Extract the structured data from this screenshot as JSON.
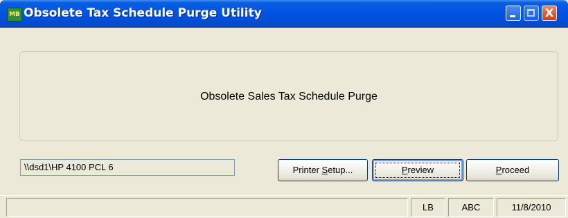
{
  "window": {
    "title": "Obsolete Tax Schedule Purge Utility",
    "icon": "mas90-app-icon",
    "icon_text": "MB"
  },
  "title_buttons": {
    "minimize": "minimize",
    "maximize": "maximize",
    "close": "X"
  },
  "main": {
    "caption": "Obsolete Sales Tax Schedule Purge"
  },
  "printer": {
    "value": "\\\\dsd1\\HP 4100 PCL 6"
  },
  "buttons": {
    "printer_setup": {
      "before": "Printer ",
      "accel": "S",
      "after": "etup..."
    },
    "preview": {
      "before": "",
      "accel": "P",
      "after": "review"
    },
    "proceed": {
      "before": "",
      "accel": "P",
      "after": "roceed"
    }
  },
  "status_bar": {
    "main": "",
    "user": "LB",
    "company": "ABC",
    "date": "11/8/2010"
  },
  "colors": {
    "titlebar": "#0054e3",
    "face": "#ece9d8",
    "button_border": "#003c74",
    "close_button": "#c8401d"
  }
}
